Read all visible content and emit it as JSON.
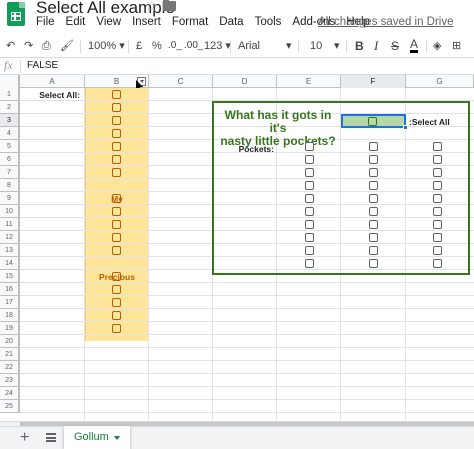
{
  "app": {
    "title": "Select All example",
    "saved_status": "All changes saved in Drive"
  },
  "menu": [
    "File",
    "Edit",
    "View",
    "Insert",
    "Format",
    "Data",
    "Tools",
    "Add-ons",
    "Help"
  ],
  "toolbar": {
    "zoom": "100%",
    "currency": "£",
    "percent": "%",
    "dec_decrease": ".0_",
    "dec_increase": ".00_",
    "more_formats": "123",
    "font": "Arial",
    "font_size": "10",
    "bold": "B",
    "italic": "I",
    "strike": "S",
    "text_color": "A"
  },
  "formula_bar": {
    "fx": "fx",
    "value": "FALSE"
  },
  "columns": [
    "A",
    "B",
    "C",
    "D",
    "E",
    "F",
    "G"
  ],
  "rows": [
    "1",
    "2",
    "3",
    "4",
    "5",
    "6",
    "7",
    "8",
    "9",
    "10",
    "11",
    "12",
    "13",
    "14",
    "15",
    "16",
    "17",
    "18",
    "19",
    "20",
    "21",
    "22",
    "23",
    "24",
    "25"
  ],
  "cells": {
    "select_all_label": "Select All:",
    "my_label": "My",
    "precious_label": "Precious",
    "riddle_line1": "What has it gots in it's",
    "riddle_line2": "nasty little pockets?",
    "select_all_right": ":Select All",
    "pockets_label": "Pockets:"
  },
  "sheet_tab": {
    "label": "Gollum"
  },
  "colors": {
    "column_b_fill": "#ffe599",
    "checkbox_orange": "#b45f06",
    "box_green": "#38761d",
    "selected_cell_fill": "#b6d7a8",
    "selection_blue": "#1a73e8"
  }
}
